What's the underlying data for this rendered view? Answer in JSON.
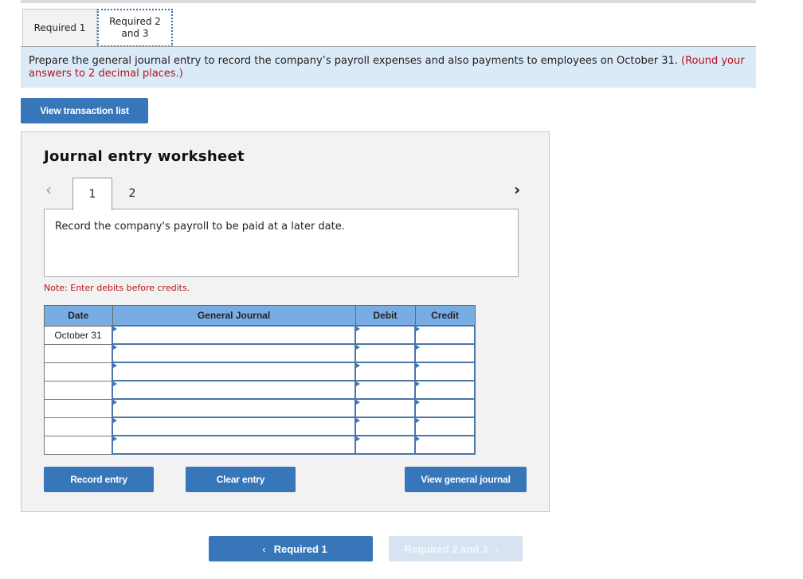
{
  "tabs": [
    {
      "label": "Required 1",
      "active": false
    },
    {
      "label": "Required 2 and 3",
      "label_line1": "Required 2",
      "label_line2": "and 3",
      "active": true
    }
  ],
  "instructions": {
    "text": "Prepare the general journal entry to record the company’s payroll expenses and also payments to employees on October 31.",
    "note": "(Round your answers to 2 decimal places.)"
  },
  "view_transaction_list_label": "View transaction list",
  "worksheet": {
    "title": "Journal entry worksheet",
    "pages": [
      "1",
      "2"
    ],
    "current_page": "1",
    "prev_icon": "chevron-left-icon",
    "next_icon": "chevron-right-icon",
    "description": "Record the company's payroll to be paid at a later date.",
    "note": "Note: Enter debits before credits.",
    "columns": [
      "Date",
      "General Journal",
      "Debit",
      "Credit"
    ],
    "rows": [
      {
        "date": "October 31",
        "account": "",
        "debit": "",
        "credit": ""
      },
      {
        "date": "",
        "account": "",
        "debit": "",
        "credit": ""
      },
      {
        "date": "",
        "account": "",
        "debit": "",
        "credit": ""
      },
      {
        "date": "",
        "account": "",
        "debit": "",
        "credit": ""
      },
      {
        "date": "",
        "account": "",
        "debit": "",
        "credit": ""
      },
      {
        "date": "",
        "account": "",
        "debit": "",
        "credit": ""
      },
      {
        "date": "",
        "account": "",
        "debit": "",
        "credit": ""
      }
    ],
    "buttons": {
      "record": "Record entry",
      "clear": "Clear entry",
      "view_general_journal": "View general journal"
    }
  },
  "bottom_nav": {
    "prev_label": "Required 1",
    "next_label": "Required 2 and 3",
    "next_disabled": true
  },
  "colors": {
    "accent": "#3876ba",
    "instruction_bg": "#dbeaf7",
    "table_header": "#79ace3",
    "warning_red": "#b5121b"
  }
}
